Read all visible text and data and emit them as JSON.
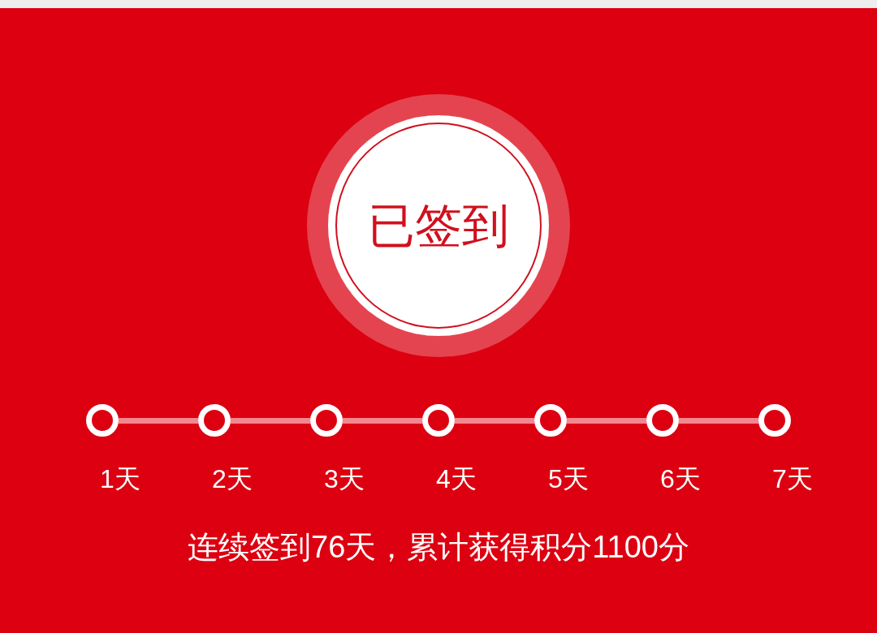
{
  "check_in_badge": {
    "label": "已签到"
  },
  "streak_days": [
    {
      "label": "1天"
    },
    {
      "label": "2天"
    },
    {
      "label": "3天"
    },
    {
      "label": "4天"
    },
    {
      "label": "5天"
    },
    {
      "label": "6天"
    },
    {
      "label": "7天"
    }
  ],
  "summary": "连续签到76天，累计获得积分1100分"
}
